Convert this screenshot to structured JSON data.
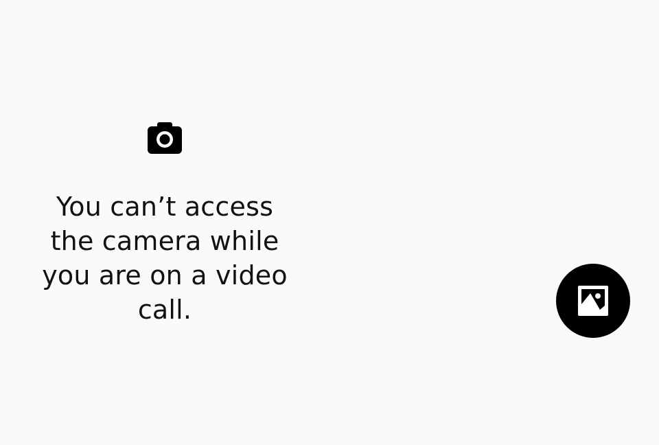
{
  "message": {
    "lines": [
      "You can’t access",
      "the camera while",
      "you are on a video",
      "call."
    ]
  },
  "icons": {
    "status": "camera-icon",
    "action": "image-gallery-icon"
  },
  "colors": {
    "background": "#fafafa",
    "text": "#111111",
    "button": "#000000",
    "icon_on_button": "#ffffff"
  }
}
